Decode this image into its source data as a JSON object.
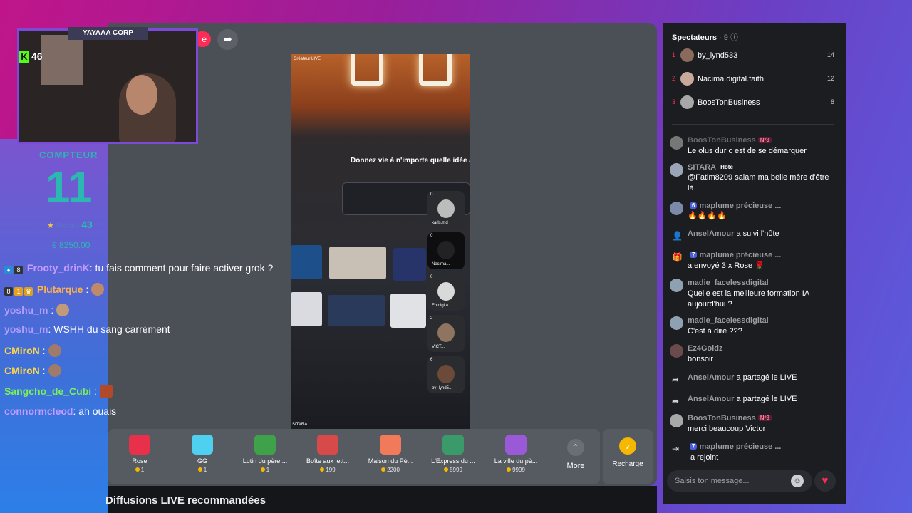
{
  "overlay": {
    "streamer_tag": "YAYAAA CORP",
    "kick_count": "46",
    "counter_label": "COMPTEUR",
    "counter_value": "11",
    "record_label": "Record",
    "record_value": "43",
    "money": "€ 8250.00"
  },
  "twitch_chat": [
    {
      "user": "Frooty_drinK",
      "color": "#c79bff",
      "text": ": tu fais comment pour faire activer grok ?"
    },
    {
      "user": "Plutarque",
      "color": "#ffb24a",
      "text": " :"
    },
    {
      "user": "yoshu_m",
      "color": "#b59cff",
      "text": " :"
    },
    {
      "user": "yoshu_m",
      "color": "#b59cff",
      "text": ": WSHH du sang carrément"
    },
    {
      "user": "CMiroN",
      "color": "#ffd54a",
      "text": " :"
    },
    {
      "user": "CMiroN",
      "color": "#ffd54a",
      "text": " :"
    },
    {
      "user": "Sangcho_de_Cubi",
      "color": "#7cf05a",
      "text": " :"
    },
    {
      "user": "connormcleod",
      "color": "#c79bff",
      "text": ": ah ouais"
    }
  ],
  "live": {
    "video_top_label": "Créateur LIVE",
    "video_heading": "Donnez vie à n'importe quelle idée avec Vi",
    "host_label": "SITARA",
    "guests": [
      {
        "count": "0",
        "name": "karls.md"
      },
      {
        "count": "0",
        "name": "Nacima..."
      },
      {
        "count": "0",
        "name": "Fb.digita..."
      },
      {
        "count": "2",
        "name": "VICT..."
      },
      {
        "count": "6",
        "name": "by_lynd5..."
      }
    ],
    "recommended_label": "Diffusions LIVE recommandées"
  },
  "gifts": [
    {
      "name": "Rose",
      "price": "1",
      "color": "#e8304a"
    },
    {
      "name": "GG",
      "price": "1",
      "color": "#4fd0f0"
    },
    {
      "name": "Lutin du père ...",
      "price": "1",
      "color": "#3fa24a"
    },
    {
      "name": "Boîte aux lett...",
      "price": "199",
      "color": "#d84a4a"
    },
    {
      "name": "Maison du Pè...",
      "price": "2200",
      "color": "#f07a5a"
    },
    {
      "name": "L'Express du ...",
      "price": "5999",
      "color": "#3a9a6a"
    },
    {
      "name": "La ville du pè...",
      "price": "9999",
      "color": "#9a5ad8"
    }
  ],
  "more_label": "More",
  "recharge_label": "Recharge",
  "viewers": {
    "header": "Spectateurs",
    "count": "· 9",
    "list": [
      {
        "rank": "1",
        "name": "by_lynd533",
        "score": "14"
      },
      {
        "rank": "2",
        "name": "Nacima.digital.faith",
        "score": "12"
      },
      {
        "rank": "3",
        "name": "BoosTonBusiness",
        "score": "8"
      }
    ]
  },
  "comments": [
    {
      "user": "BoosTonBusiness",
      "badge": "Nº3",
      "text": "Le olus dur c est de se démarquer"
    },
    {
      "user": "SITARA",
      "badge": "Hôte",
      "text": "@Fatim8209 salam ma belle mère d'être là"
    },
    {
      "user": "maplume précieuse ...",
      "badge": "6",
      "text": "🔥🔥🔥🔥"
    },
    {
      "user": "AnselAmour",
      "action": "a suivi l'hôte"
    },
    {
      "user": "maplume précieuse ...",
      "badge": "7",
      "text": "a envoyé 3 x Rose 🌹"
    },
    {
      "user": "madie_facelessdigital",
      "text": "Quelle est la meilleure formation IA aujourd'hui ?"
    },
    {
      "user": "madie_facelessdigital",
      "text": "C'est à dire ???"
    },
    {
      "user": "Ez4Goldz",
      "text": "bonsoir"
    },
    {
      "user": "AnselAmour",
      "action": "a partagé le LIVE"
    },
    {
      "user": "AnselAmour",
      "action": "a partagé le LIVE"
    },
    {
      "user": "BoosTonBusiness",
      "badge": "Nº3",
      "text": "merci beaucoup Victor"
    },
    {
      "user": "maplume précieuse ...",
      "badge": "7",
      "text": "a rejoint"
    }
  ],
  "input_placeholder": "Saisis ton message...",
  "colors": {
    "accent": "#fe2c55",
    "counter": "#2bb8b0",
    "kick": "#53fc18"
  }
}
